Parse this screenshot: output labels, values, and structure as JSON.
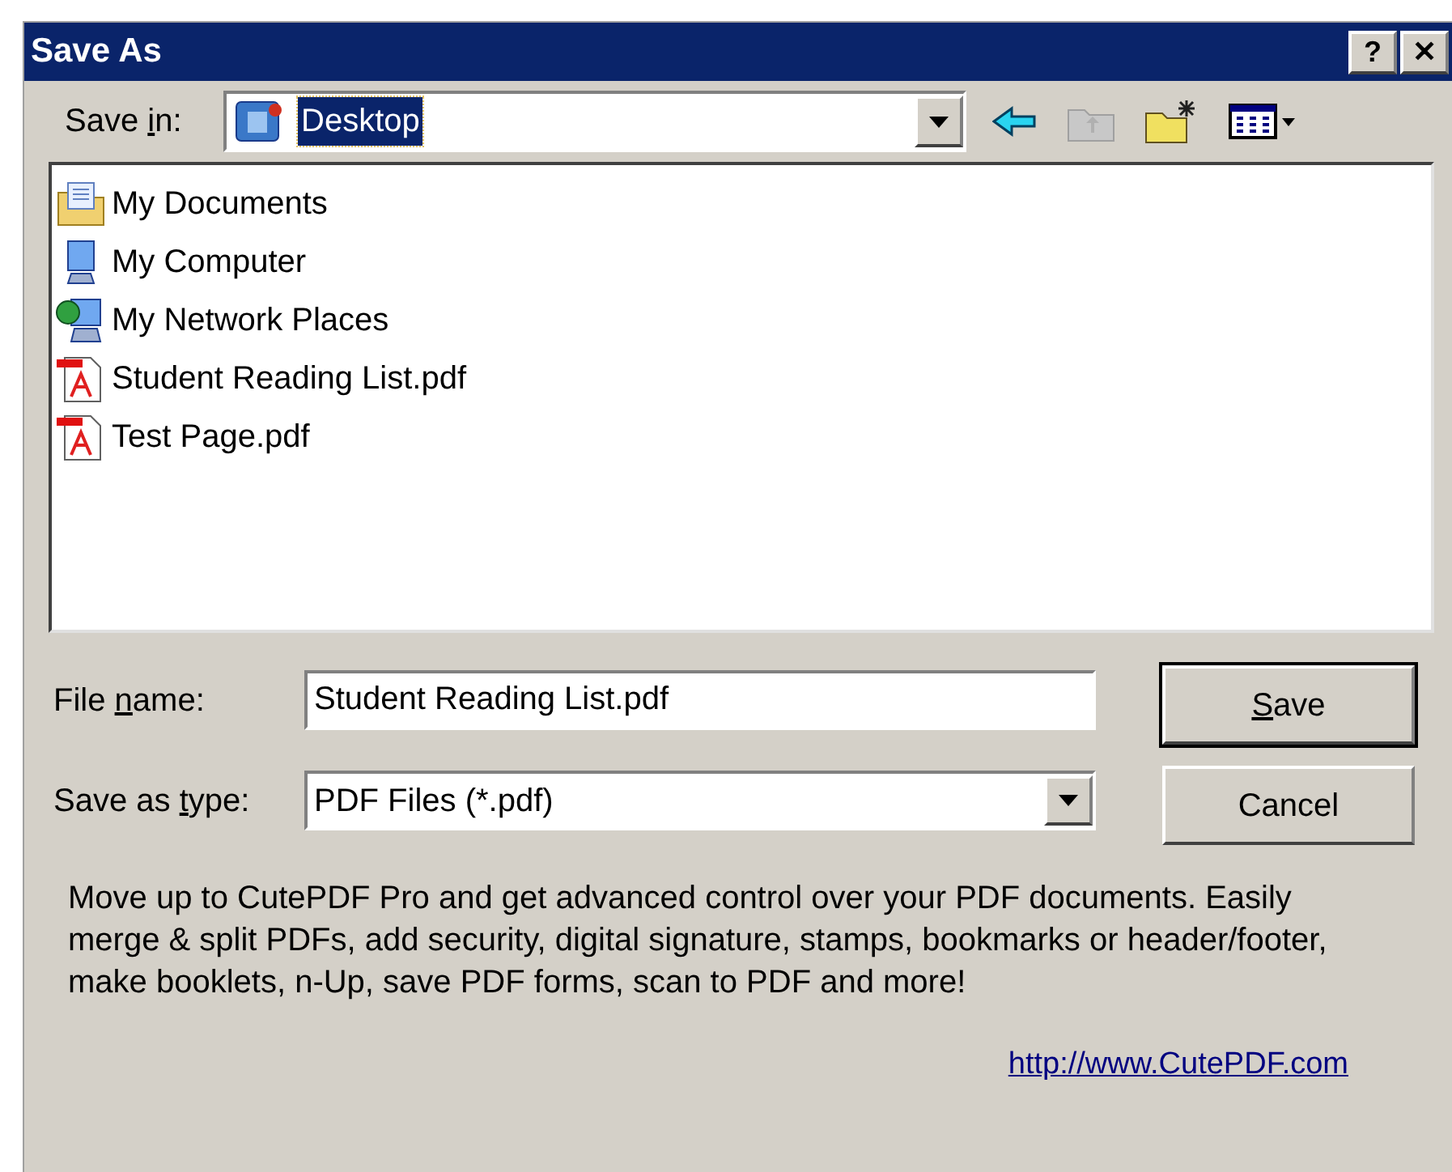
{
  "window": {
    "title": "Save As",
    "title_buttons": [
      "?",
      "✕"
    ]
  },
  "save_in": {
    "label": {
      "before": "Save ",
      "key": "i",
      "after": "n:"
    },
    "value": "Desktop",
    "selected": true
  },
  "files": [
    {
      "name": "My Documents",
      "kind": "documents"
    },
    {
      "name": "My Computer",
      "kind": "computer"
    },
    {
      "name": "My Network Places",
      "kind": "network"
    },
    {
      "name": "Student Reading List.pdf",
      "kind": "pdf"
    },
    {
      "name": "Test Page.pdf",
      "kind": "pdf"
    }
  ],
  "file_name": {
    "label": {
      "before": "File ",
      "key": "n",
      "after": "ame:"
    },
    "value": "Student Reading List.pdf"
  },
  "save_as_type": {
    "label": {
      "before": "Save as ",
      "key": "t",
      "after": "ype:"
    },
    "value": "PDF Files (*.pdf)"
  },
  "buttons": [
    {
      "label": {
        "key": "S",
        "after": "ave"
      },
      "default": true
    },
    {
      "label": {
        "before": "Cancel"
      },
      "default": false
    }
  ],
  "promo": "Move up to CutePDF Pro and get advanced control over your PDF documents. Easily merge & split PDFs, add security, digital signature, stamps, bookmarks or header/footer, make booklets, n-Up, save PDF forms, scan to PDF and more!",
  "link": "http://www.CutePDF.com"
}
